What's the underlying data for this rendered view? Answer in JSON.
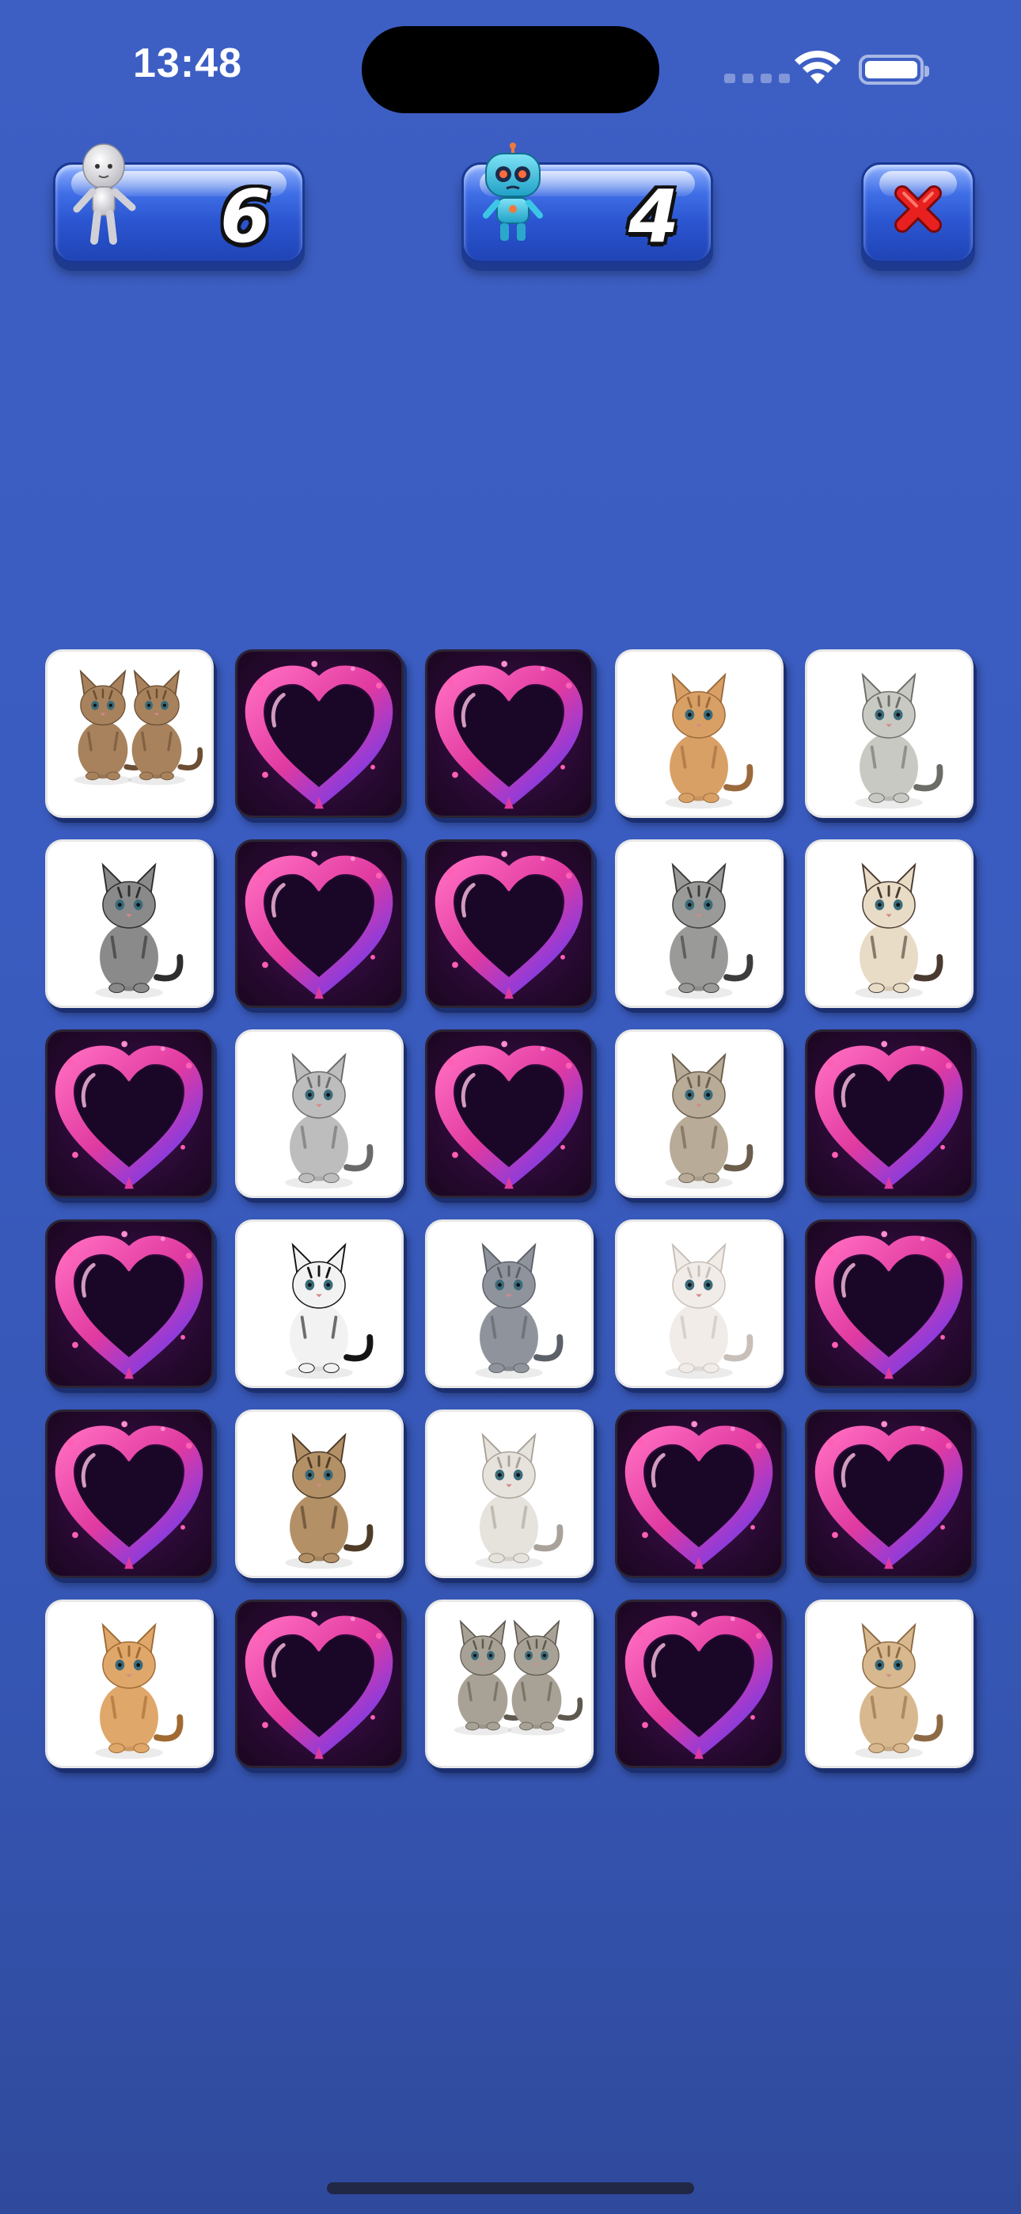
{
  "status_bar": {
    "time": "13:48"
  },
  "scoreboard": {
    "player": {
      "score": "6",
      "avatar_icon": "human-figure-icon"
    },
    "robot": {
      "score": "4",
      "avatar_icon": "robot-icon"
    },
    "close_icon": "close-x-icon"
  },
  "board": {
    "columns": 5,
    "rows": 6,
    "cards": [
      "two-tabby-kittens",
      "back",
      "back",
      "orange-kitten",
      "spotted-bengal-cat",
      "fluffy-gray-kitten",
      "back",
      "back",
      "gray-tabby-kitten",
      "siamese-cat",
      "back",
      "silver-tabby-sitting",
      "back",
      "tabby-cat-sitting",
      "back",
      "back",
      "black-white-kitten",
      "british-shorthair",
      "white-persian-cat",
      "back",
      "back",
      "tabby-kitten-lying",
      "white-fluffy-cat",
      "back",
      "back",
      "ginger-kitten",
      "back",
      "two-gray-kittens",
      "back",
      "cream-cat-standing"
    ]
  },
  "colors": {
    "background_top": "#3d5fc4",
    "background_bottom": "#2f4a9c",
    "panel_blue": "#2b55d0",
    "heart_pink": "#ff4fa8",
    "close_red": "#e02020"
  }
}
